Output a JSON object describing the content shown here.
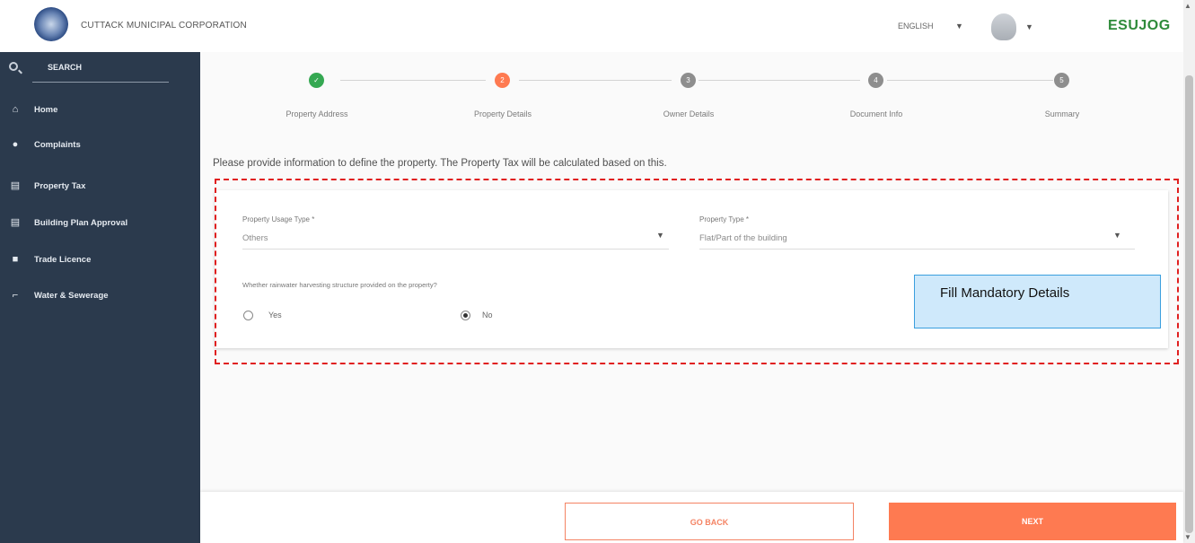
{
  "header": {
    "corporation_name": "CUTTACK MUNICIPAL CORPORATION",
    "language": "ENGLISH",
    "brand": "ESUJOG"
  },
  "sidebar": {
    "search_label": "SEARCH",
    "items": [
      {
        "label": "Home",
        "icon": "home-icon"
      },
      {
        "label": "Complaints",
        "icon": "person-icon"
      },
      {
        "label": "Property Tax",
        "icon": "document-icon"
      },
      {
        "label": "Building Plan Approval",
        "icon": "document-icon"
      },
      {
        "label": "Trade Licence",
        "icon": "briefcase-icon"
      },
      {
        "label": "Water & Sewerage",
        "icon": "tap-icon"
      }
    ]
  },
  "stepper": {
    "steps": [
      {
        "label": "Property Address",
        "status": "completed",
        "number": ""
      },
      {
        "label": "Property Details",
        "status": "active",
        "number": "2"
      },
      {
        "label": "Owner Details",
        "status": "pending",
        "number": "3"
      },
      {
        "label": "Document Info",
        "status": "pending",
        "number": "4"
      },
      {
        "label": "Summary",
        "status": "pending",
        "number": "5"
      }
    ],
    "colors": {
      "completed": "#35a852",
      "active": "#fe7a51",
      "pending": "#8e8e8e"
    }
  },
  "form": {
    "info_text": "Please provide information to define the property. The Property Tax will be calculated based on this.",
    "usage_type": {
      "label": "Property Usage Type *",
      "value": "Others"
    },
    "property_type": {
      "label": "Property Type *",
      "value": "Flat/Part of the building"
    },
    "rainwater_question": "Whether rainwater harvesting structure provided on the property?",
    "options": [
      {
        "label": "Yes",
        "checked": false
      },
      {
        "label": "No",
        "checked": true
      }
    ]
  },
  "callout": {
    "text": "Fill Mandatory Details"
  },
  "footer": {
    "back_label": "GO BACK",
    "next_label": "NEXT"
  }
}
